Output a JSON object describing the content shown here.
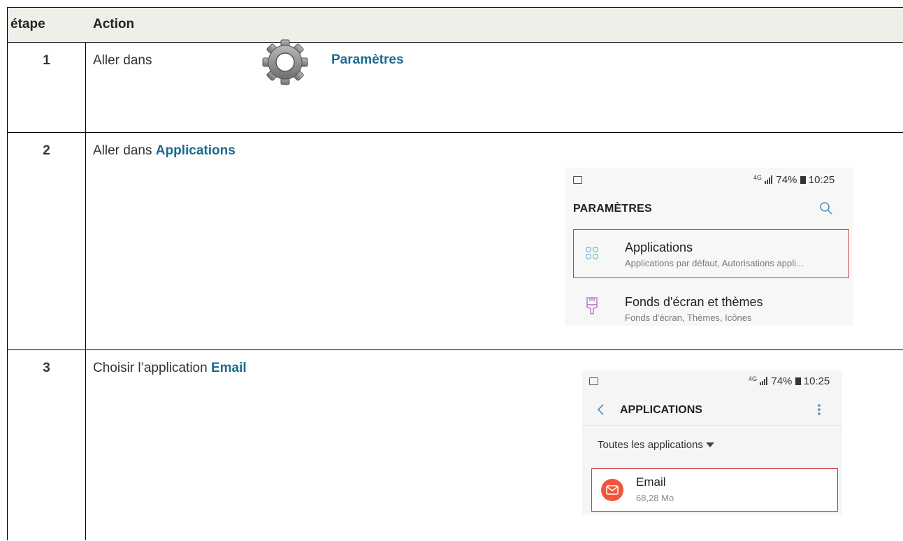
{
  "table": {
    "header": {
      "step": "étape",
      "action": "Action"
    },
    "rows": [
      {
        "step": "1",
        "text": "Aller dans",
        "highlight": "Paramètres"
      },
      {
        "step": "2",
        "text": "Aller dans ",
        "highlight": "Applications"
      },
      {
        "step": "3",
        "text": "Choisir l’application ",
        "highlight": "Email"
      }
    ]
  },
  "screenshot1": {
    "status": "74%",
    "time": "10:25",
    "title": "PARAMÈTRES",
    "items": [
      {
        "icon": "grid-icon",
        "title": "Applications",
        "subtitle": "Applications par défaut, Autorisations appli..."
      },
      {
        "icon": "brush-icon",
        "title": "Fonds d'écran et thèmes",
        "subtitle": "Fonds d'écran, Thèmes, Icônes"
      }
    ]
  },
  "screenshot2": {
    "status": "74%",
    "time": "10:25",
    "title": "APPLICATIONS",
    "filter": "Toutes les applications",
    "app": {
      "name": "Email",
      "size": "68,28 Mo"
    }
  },
  "colors": {
    "highlight": "#1c6a8e",
    "box": "#d23b3b",
    "email": "#f0563c",
    "header_bg": "#efefea"
  }
}
